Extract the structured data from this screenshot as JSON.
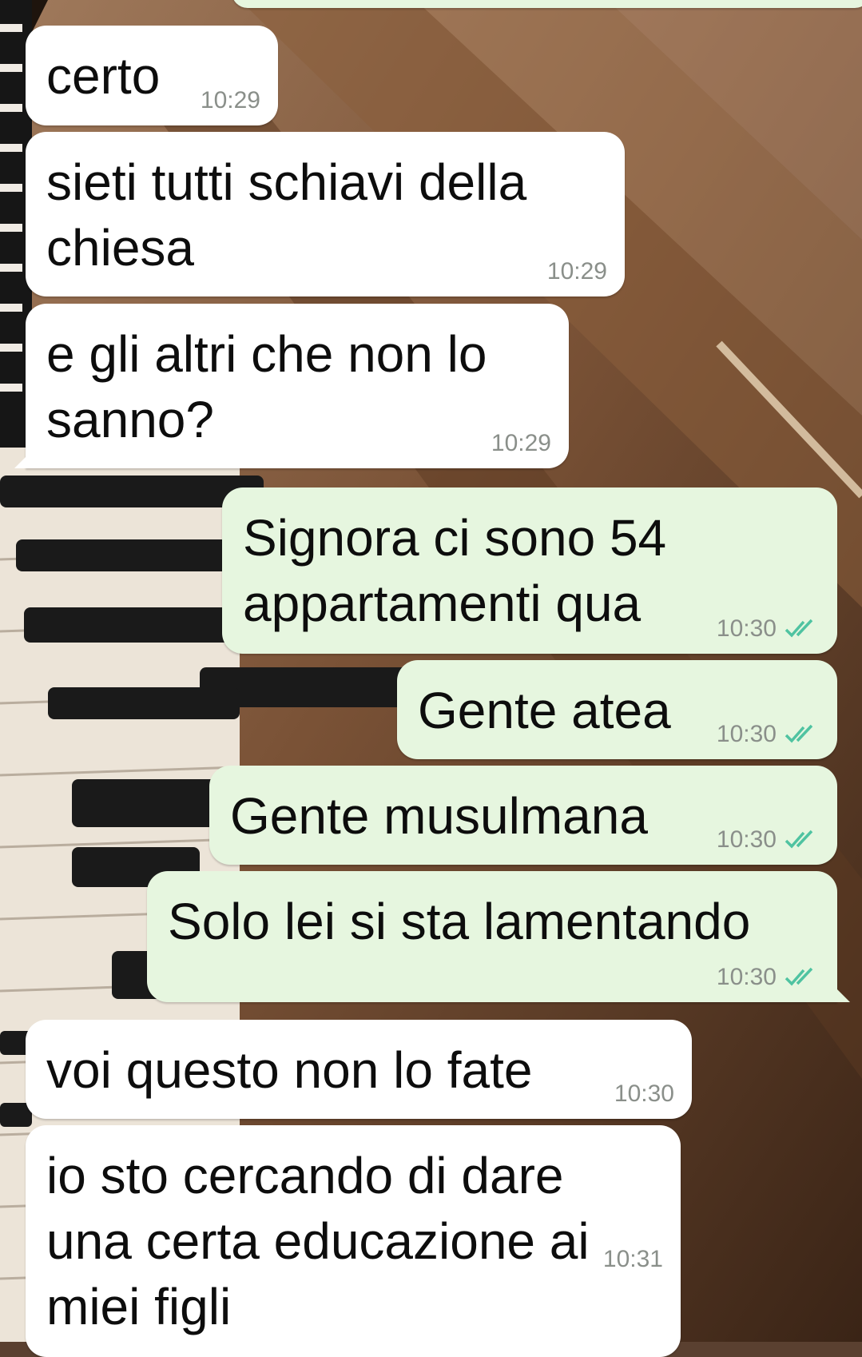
{
  "colors": {
    "incoming_bubble": "#ffffff",
    "outgoing_bubble": "#e6f6df",
    "read_ticks": "#4fc3a1",
    "timestamp": "#8a8f8a"
  },
  "messages": [
    {
      "direction": "incoming",
      "text": "certo",
      "time": "10:29"
    },
    {
      "direction": "incoming",
      "text": "sieti tutti schiavi della\nchiesa",
      "time": "10:29"
    },
    {
      "direction": "incoming",
      "text": "e gli altri che non lo\nsanno?",
      "time": "10:29"
    },
    {
      "direction": "outgoing",
      "text": "Signora ci sono 54\nappartamenti qua",
      "time": "10:30",
      "status_icon": "double-check-icon"
    },
    {
      "direction": "outgoing",
      "text": "Gente atea",
      "time": "10:30",
      "status_icon": "double-check-icon"
    },
    {
      "direction": "outgoing",
      "text": "Gente musulmana",
      "time": "10:30",
      "status_icon": "double-check-icon"
    },
    {
      "direction": "outgoing",
      "text": "Solo lei si sta lamentando",
      "time": "10:30",
      "status_icon": "double-check-icon"
    },
    {
      "direction": "incoming",
      "text": "voi questo non lo fate",
      "time": "10:30"
    },
    {
      "direction": "incoming",
      "text": "io sto cercando di dare\nuna certa educazione ai\nmiei figli",
      "time": "10:31"
    }
  ]
}
